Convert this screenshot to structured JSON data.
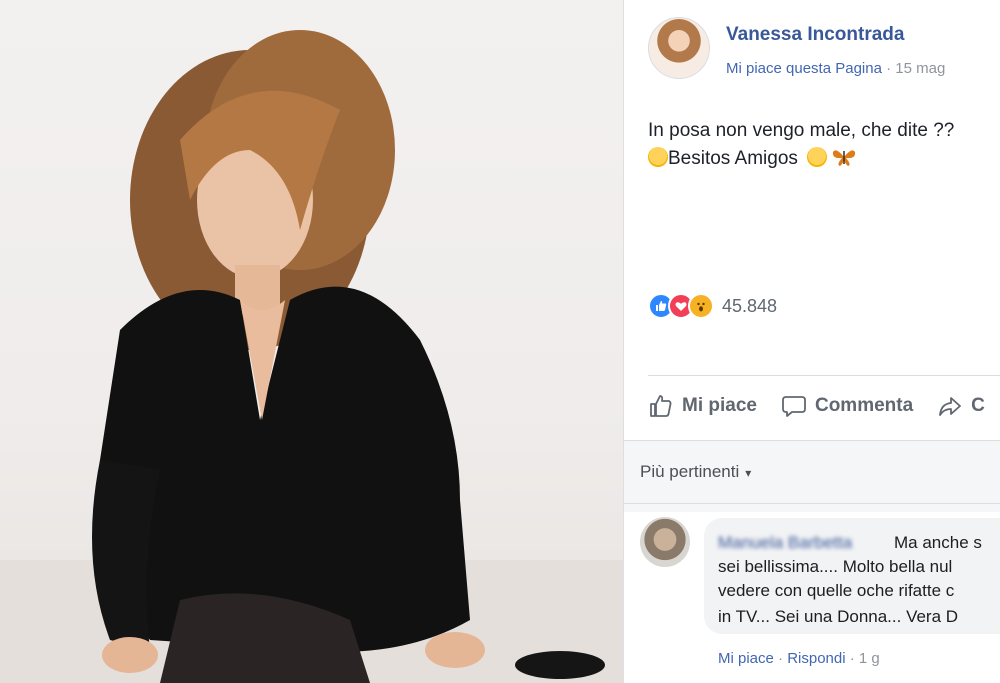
{
  "post": {
    "author": "Vanessa Incontrada",
    "page_like_label": "Mi piace questa Pagina",
    "separator": "·",
    "date": "15 mag",
    "text_line1": "In posa non vengo male, che dite ??",
    "text_line2": "Besitos Amigos",
    "reaction_count": "45.848",
    "reaction_icons": [
      "like-icon",
      "love-icon",
      "wow-icon"
    ]
  },
  "actions": {
    "like": "Mi piace",
    "comment": "Commenta",
    "share": "C"
  },
  "comments_sort": {
    "label": "Più pertinenti",
    "caret": "▾"
  },
  "comment": {
    "author": "Manuela Barbetta",
    "lines": [
      "Ma anche s",
      "sei bellissima.... Molto bella nul",
      "vedere con quelle oche rifatte c",
      "in TV... Sei una Donna... Vera D"
    ],
    "like_label": "Mi piace",
    "reply_label": "Rispondi",
    "separator": "·",
    "time": "1 g"
  },
  "colors": {
    "link_blue": "#385898",
    "action_gray": "#606770",
    "like_blue": "#2d88ff",
    "love_red": "#f33e58",
    "wow_yellow": "#f7b125"
  }
}
